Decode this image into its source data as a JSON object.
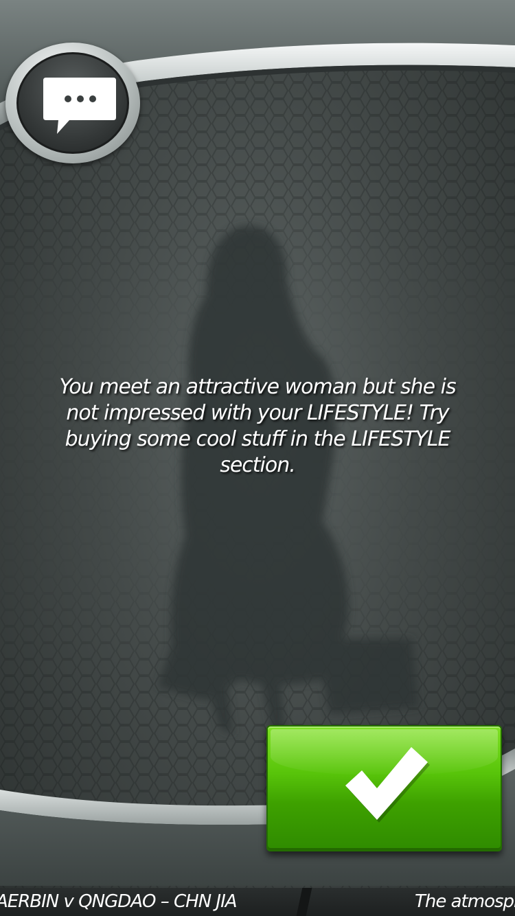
{
  "dialog": {
    "message": "You meet an attractive woman but she is not impressed with your LIFESTYLE! Try buying some cool stuff in the LIFESTYLE section."
  },
  "icons": {
    "badge": "speech-bubble-ellipsis-icon",
    "confirm": "checkmark-icon"
  },
  "colors": {
    "confirm_green": "#4cb305",
    "background": "#444a49"
  },
  "ticker": {
    "items": [
      "AERBIN v QNGDAO – CHN JIA",
      "The atmosph"
    ]
  }
}
